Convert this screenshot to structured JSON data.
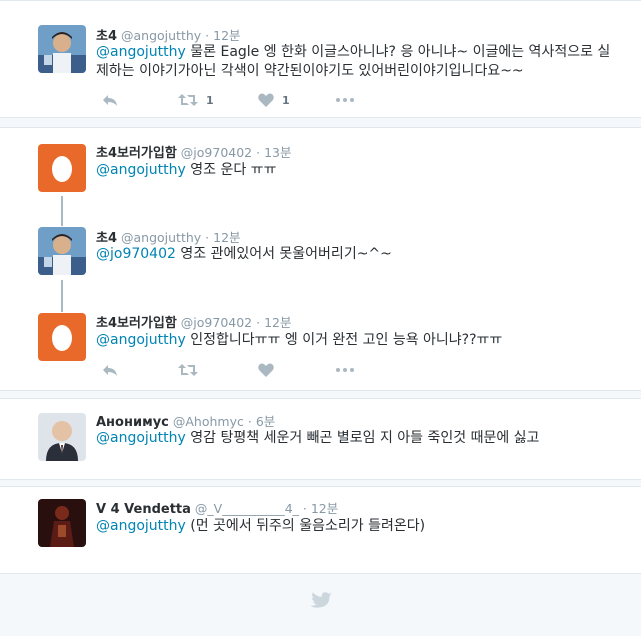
{
  "tweets": [
    {
      "name": "초4",
      "handle": "@angojutthy",
      "time": "12분",
      "mention": "@angojutthy",
      "text": " 물론 Eagle 엥 한화 이글스아니냐? 응 아니냐~ 이글에는 역사적으로 실제하는 이야기가아닌 각색이 약간된이야기도 있어버린이야기입니다요~~",
      "retweets": "1",
      "likes": "1"
    },
    {
      "name": "초4보러가입함",
      "handle": "@jo970402",
      "time": "13분",
      "mention": "@angojutthy",
      "text": " 영조 운다 ㅠㅠ"
    },
    {
      "name": "초4",
      "handle": "@angojutthy",
      "time": "12분",
      "mention": "@jo970402",
      "text": " 영조 관에있어서 못울어버리기~^~"
    },
    {
      "name": "초4보러가입함",
      "handle": "@jo970402",
      "time": "12분",
      "mention": "@angojutthy",
      "text": " 인정합니다ㅠㅠ 엥 이거 완전 고인 능욕 아니냐??ㅠㅠ"
    },
    {
      "name": "Анонимус",
      "handle": "@Ahohmyc",
      "time": "6분",
      "mention": "@angojutthy",
      "text": " 영감 탕평책 세운거 빼곤 별로임 지 아들 죽인것 때문에 싫고"
    },
    {
      "name": "V 4 Vendetta",
      "handle": "@_V__________4_",
      "time": "12분",
      "mention": "@angojutthy",
      "text": " (먼 곳에서 뒤주의 울음소리가 들려온다)"
    }
  ],
  "separator": "·",
  "icons": [
    "reply-icon",
    "retweet-icon",
    "heart-icon",
    "more-icon",
    "twitter-bird-icon",
    "egg-avatar-icon"
  ],
  "colors": {
    "background": "#f5f8fa",
    "mention": "#0084b4",
    "egg_avatar": "#e8692a",
    "icon_gray": "#aab8c2",
    "bird": "#ccd6dd"
  }
}
